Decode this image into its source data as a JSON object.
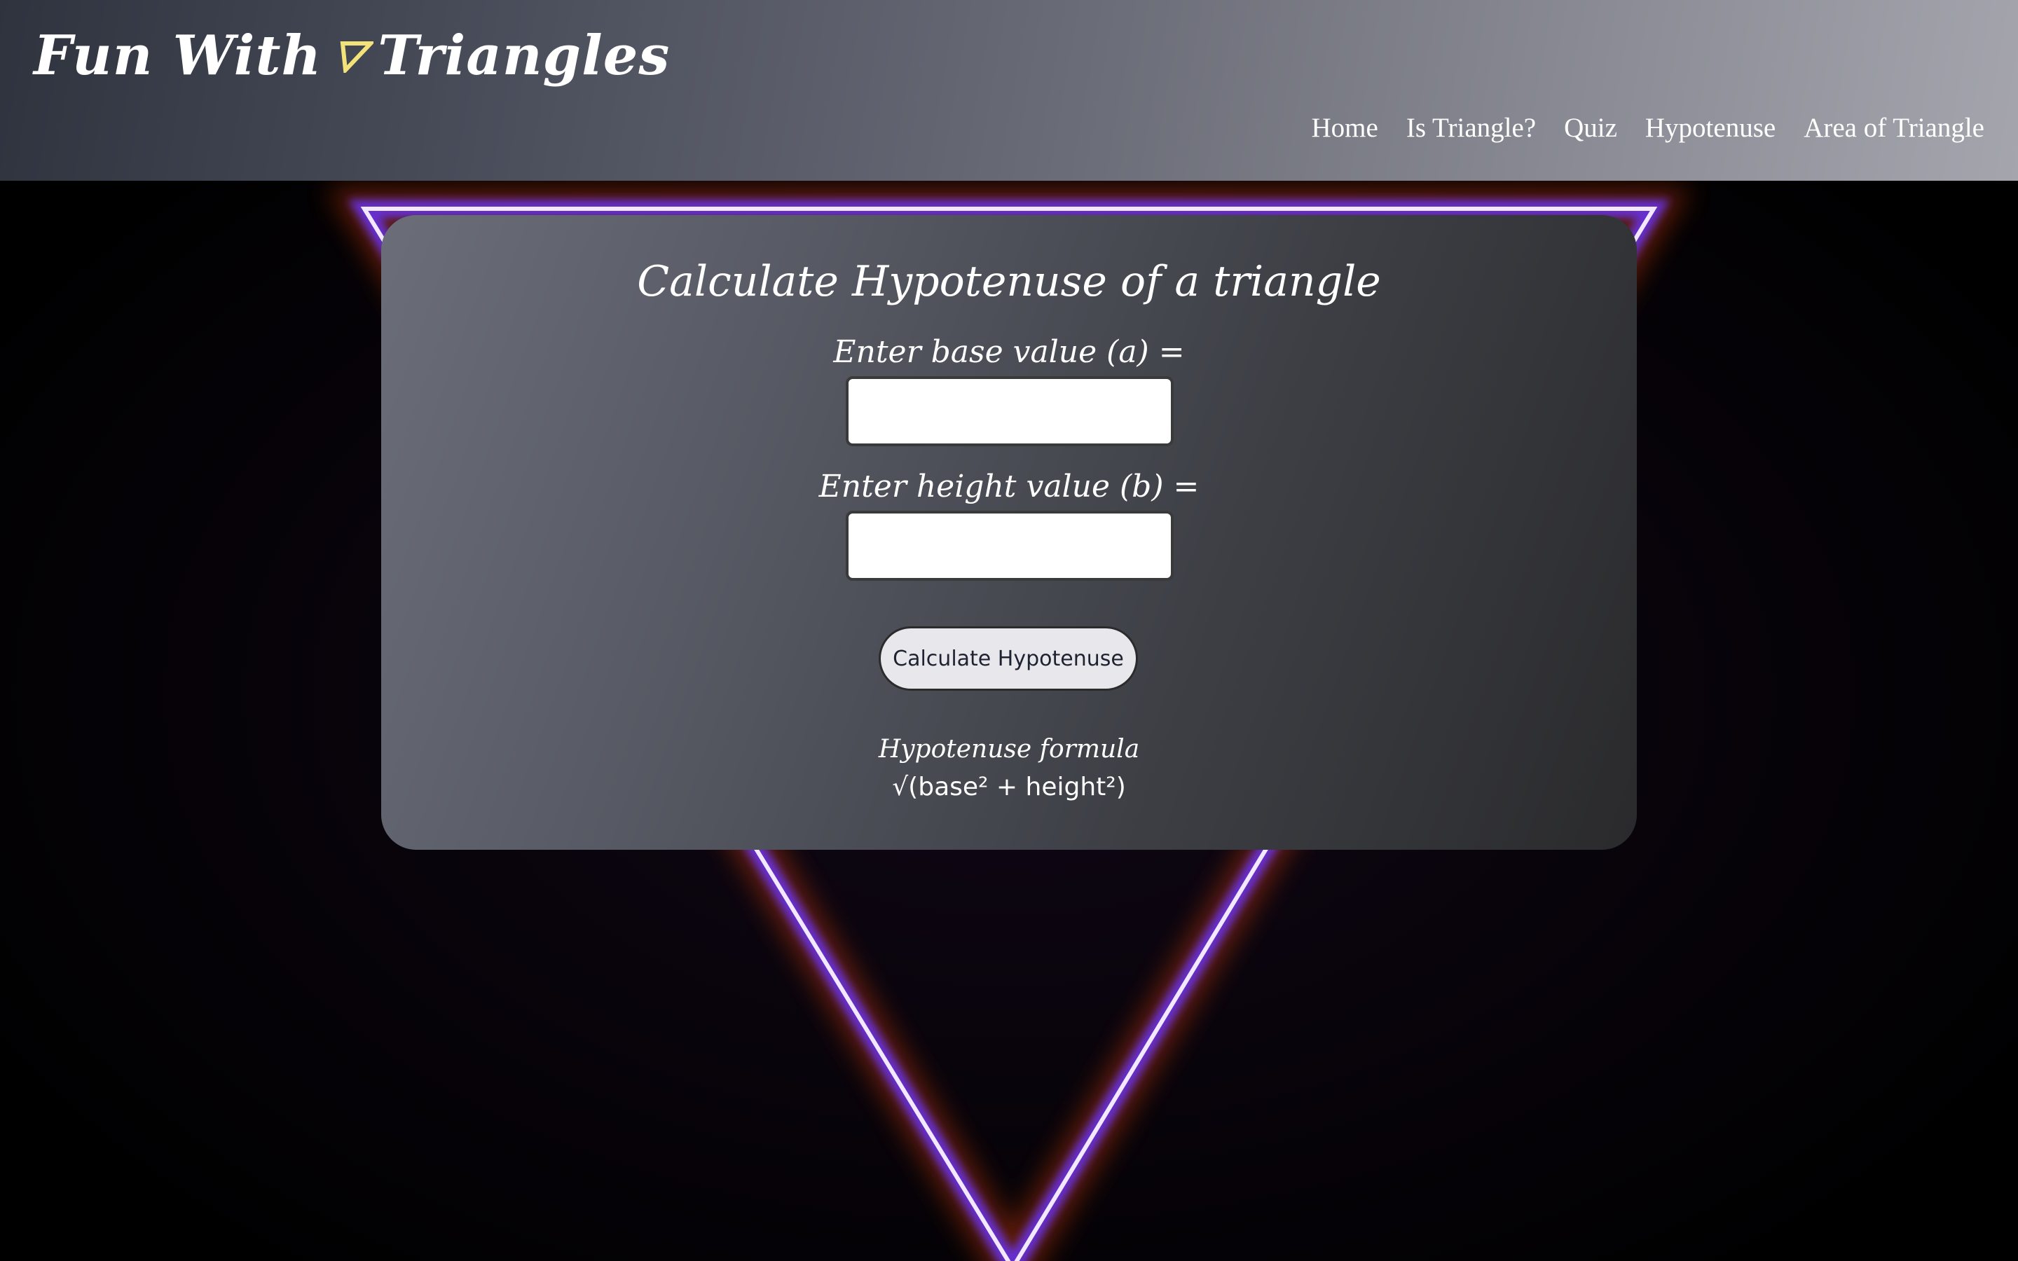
{
  "header": {
    "brand_prefix": "Fun With",
    "brand_suffix": "Triangles",
    "brand_icon": "triangle-icon",
    "brand_icon_color": "#f3e27a",
    "nav": [
      {
        "label": "Home"
      },
      {
        "label": "Is Triangle?"
      },
      {
        "label": "Quiz"
      },
      {
        "label": "Hypotenuse"
      },
      {
        "label": "Area of Triangle"
      }
    ]
  },
  "main": {
    "title": "Calculate Hypotenuse of a triangle",
    "base_label": "Enter base value (a) =",
    "base_value": "",
    "height_label": "Enter height value (b) =",
    "height_value": "",
    "button_label": "Calculate Hypotenuse",
    "formula_label": "Hypotenuse formula",
    "formula": "√(base² + height²)"
  },
  "colors": {
    "neon_line": "#f2e8ff",
    "neon_glow": "#7a3cff",
    "neon_warm": "#ff5a1e"
  }
}
